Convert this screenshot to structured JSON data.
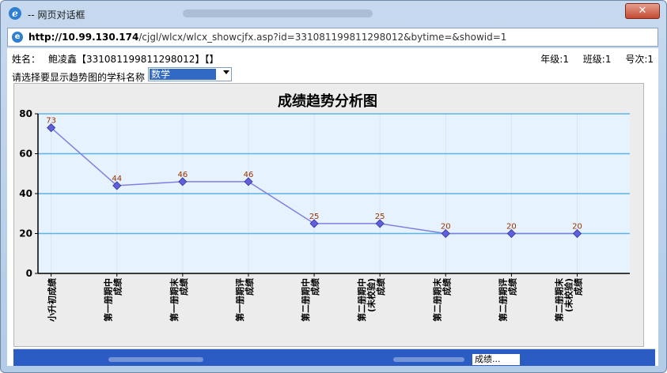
{
  "window": {
    "title": "-- 网页对话框",
    "close_label": "✕",
    "url_host": "http://10.99.130.174",
    "url_path": "/cjgl/wlcx/wlcx_showcjfx.asp?id=331081199811298012&bytime=&showid=1"
  },
  "student": {
    "name_label": "姓名：",
    "name_value": "鲍凌鑫【331081199811298012】【】",
    "grade": "年级:1",
    "class": "班级:1",
    "number": "号次:1"
  },
  "subject_select": {
    "label": "请选择要显示趋势图的学科名称",
    "selected": "数学"
  },
  "chart_data": {
    "type": "line",
    "title": "成绩趋势分析图",
    "categories": [
      "小升初成绩",
      "第一册期中成绩",
      "第一册期末成绩",
      "第一册期评成绩",
      "第二册期中成绩",
      "第二册期中(未校验)成绩",
      "第二册期末成绩",
      "第二册期评成绩",
      "第二册期末(未校验)成绩"
    ],
    "category_lines": [
      [
        "小升初成绩"
      ],
      [
        "第一册期中",
        "成绩"
      ],
      [
        "第一册期末",
        "成绩"
      ],
      [
        "第一册期评",
        "成绩"
      ],
      [
        "第二册期中",
        "成绩"
      ],
      [
        "第二册期中",
        "(未校验)",
        "成绩"
      ],
      [
        "第二册期末",
        "成绩"
      ],
      [
        "第二册期评",
        "成绩"
      ],
      [
        "第二册期末",
        "(未校验)",
        "成绩"
      ]
    ],
    "values": [
      73,
      44,
      46,
      46,
      25,
      25,
      20,
      20,
      20
    ],
    "ylim": [
      0,
      80
    ],
    "yticks": [
      0,
      20,
      40,
      60,
      80
    ],
    "grid": true,
    "colors": {
      "line": "#8080e0",
      "marker": "#6060d8",
      "label": "#993300",
      "plot_bg": "#e6f2fd",
      "grid": "#5cb3e6"
    }
  },
  "bottom": {
    "field_text": "成绩..."
  }
}
